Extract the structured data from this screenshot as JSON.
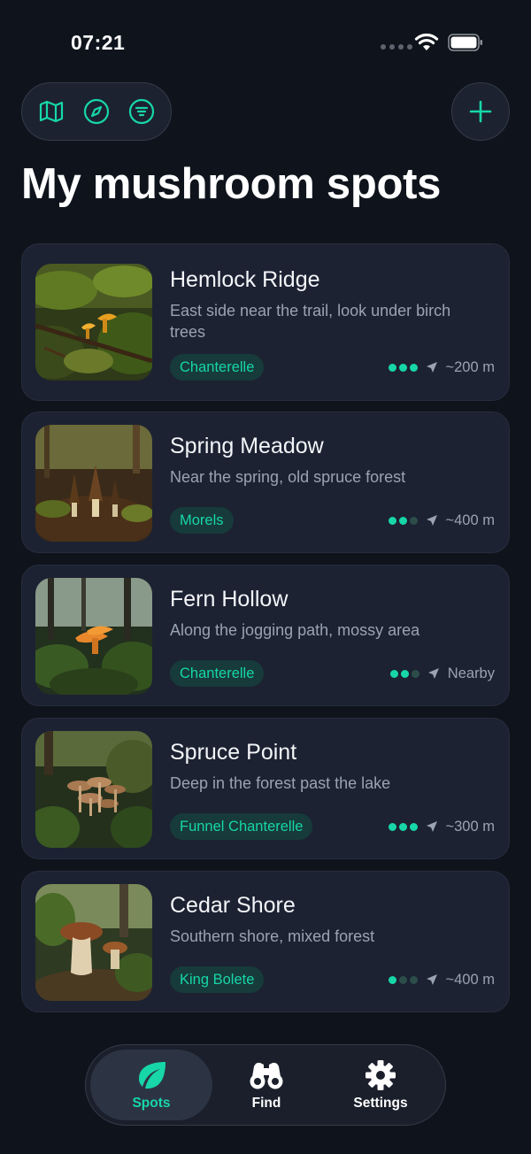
{
  "status_bar": {
    "time": "07:21"
  },
  "toolbar": {
    "icons": [
      "map-icon",
      "compass-icon",
      "filter-icon"
    ],
    "add_icon": "plus-icon"
  },
  "page": {
    "title": "My mushroom spots"
  },
  "colors": {
    "accent": "#17d6a8",
    "background": "#0f141c",
    "card": "#1c2232",
    "tag_bg": "#173a3a"
  },
  "spots": [
    {
      "name": "Hemlock Ridge",
      "description": "East side near the trail, look under birch trees",
      "tag": "Chanterelle",
      "rating": 3,
      "rating_max": 3,
      "distance": "~200 m",
      "image": "chanterelle-moss-photo"
    },
    {
      "name": "Spring Meadow",
      "description": "Near the spring, old spruce forest",
      "tag": "Morels",
      "rating": 2,
      "rating_max": 3,
      "distance": "~400 m",
      "image": "morels-photo"
    },
    {
      "name": "Fern Hollow",
      "description": "Along the jogging path, mossy area",
      "tag": "Chanterelle",
      "rating": 2,
      "rating_max": 3,
      "distance": "Nearby",
      "image": "chanterelle-ferns-photo"
    },
    {
      "name": "Spruce Point",
      "description": "Deep in the forest past the lake",
      "tag": "Funnel Chanterelle",
      "rating": 3,
      "rating_max": 3,
      "distance": "~300 m",
      "image": "funnel-chanterelle-photo"
    },
    {
      "name": "Cedar Shore",
      "description": "Southern shore, mixed forest",
      "tag": "King Bolete",
      "rating": 1,
      "rating_max": 3,
      "distance": "~400 m",
      "image": "king-bolete-photo"
    }
  ],
  "tab_bar": {
    "tabs": [
      {
        "label": "Spots",
        "icon": "leaf-icon",
        "active": true
      },
      {
        "label": "Find",
        "icon": "binoculars-icon",
        "active": false
      },
      {
        "label": "Settings",
        "icon": "gear-icon",
        "active": false
      }
    ]
  }
}
